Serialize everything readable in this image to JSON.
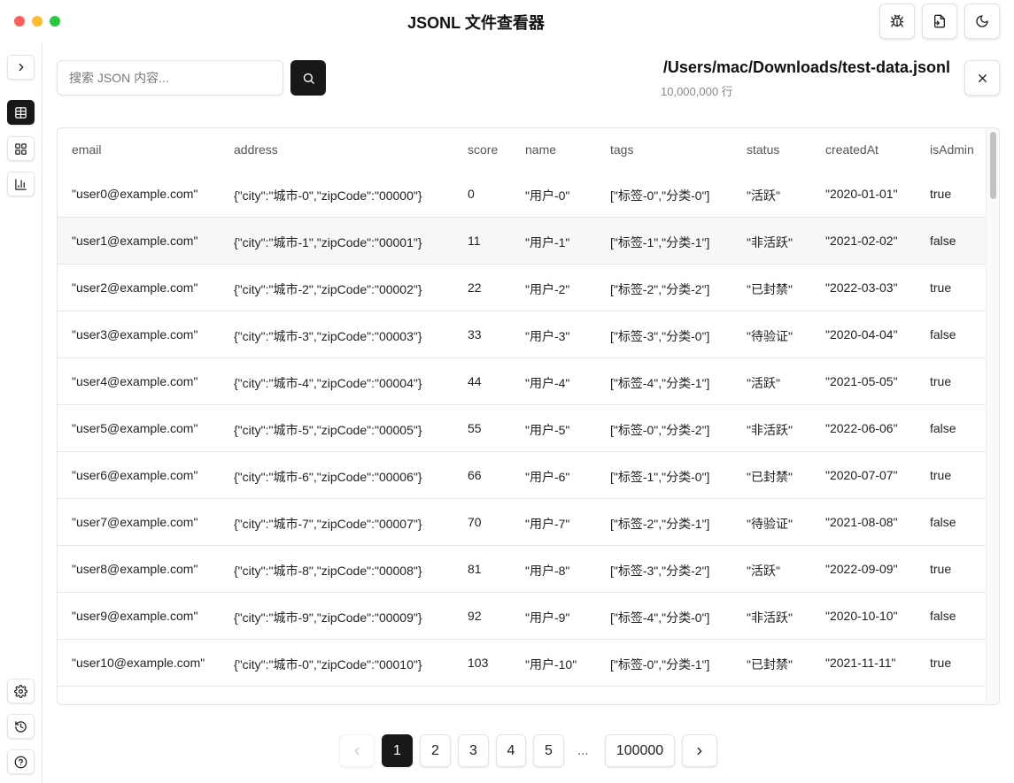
{
  "app": {
    "title": "JSONL 文件查看器"
  },
  "search": {
    "placeholder": "搜索 JSON 内容..."
  },
  "file": {
    "path": "/Users/mac/Downloads/test-data.jsonl",
    "line_count": "10,000,000 行"
  },
  "columns": [
    "email",
    "address",
    "score",
    "name",
    "tags",
    "status",
    "createdAt",
    "isAdmin"
  ],
  "rows": [
    [
      "\"user0@example.com\"",
      "{\"city\":\"城市-0\",\"zipCode\":\"00000\"}",
      "0",
      "\"用户-0\"",
      "[\"标签-0\",\"分类-0\"]",
      "\"活跃\"",
      "\"2020-01-01\"",
      "true"
    ],
    [
      "\"user1@example.com\"",
      "{\"city\":\"城市-1\",\"zipCode\":\"00001\"}",
      "11",
      "\"用户-1\"",
      "[\"标签-1\",\"分类-1\"]",
      "\"非活跃\"",
      "\"2021-02-02\"",
      "false"
    ],
    [
      "\"user2@example.com\"",
      "{\"city\":\"城市-2\",\"zipCode\":\"00002\"}",
      "22",
      "\"用户-2\"",
      "[\"标签-2\",\"分类-2\"]",
      "\"已封禁\"",
      "\"2022-03-03\"",
      "true"
    ],
    [
      "\"user3@example.com\"",
      "{\"city\":\"城市-3\",\"zipCode\":\"00003\"}",
      "33",
      "\"用户-3\"",
      "[\"标签-3\",\"分类-0\"]",
      "\"待验证\"",
      "\"2020-04-04\"",
      "false"
    ],
    [
      "\"user4@example.com\"",
      "{\"city\":\"城市-4\",\"zipCode\":\"00004\"}",
      "44",
      "\"用户-4\"",
      "[\"标签-4\",\"分类-1\"]",
      "\"活跃\"",
      "\"2021-05-05\"",
      "true"
    ],
    [
      "\"user5@example.com\"",
      "{\"city\":\"城市-5\",\"zipCode\":\"00005\"}",
      "55",
      "\"用户-5\"",
      "[\"标签-0\",\"分类-2\"]",
      "\"非活跃\"",
      "\"2022-06-06\"",
      "false"
    ],
    [
      "\"user6@example.com\"",
      "{\"city\":\"城市-6\",\"zipCode\":\"00006\"}",
      "66",
      "\"用户-6\"",
      "[\"标签-1\",\"分类-0\"]",
      "\"已封禁\"",
      "\"2020-07-07\"",
      "true"
    ],
    [
      "\"user7@example.com\"",
      "{\"city\":\"城市-7\",\"zipCode\":\"00007\"}",
      "70",
      "\"用户-7\"",
      "[\"标签-2\",\"分类-1\"]",
      "\"待验证\"",
      "\"2021-08-08\"",
      "false"
    ],
    [
      "\"user8@example.com\"",
      "{\"city\":\"城市-8\",\"zipCode\":\"00008\"}",
      "81",
      "\"用户-8\"",
      "[\"标签-3\",\"分类-2\"]",
      "\"活跃\"",
      "\"2022-09-09\"",
      "true"
    ],
    [
      "\"user9@example.com\"",
      "{\"city\":\"城市-9\",\"zipCode\":\"00009\"}",
      "92",
      "\"用户-9\"",
      "[\"标签-4\",\"分类-0\"]",
      "\"非活跃\"",
      "\"2020-10-10\"",
      "false"
    ],
    [
      "\"user10@example.com\"",
      "{\"city\":\"城市-0\",\"zipCode\":\"00010\"}",
      "103",
      "\"用户-10\"",
      "[\"标签-0\",\"分类-1\"]",
      "\"已封禁\"",
      "\"2021-11-11\"",
      "true"
    ]
  ],
  "pagination": {
    "pages": [
      "1",
      "2",
      "3",
      "4",
      "5"
    ],
    "current": "1",
    "ellipsis": "...",
    "last": "100000"
  },
  "icons": {
    "titlebar": [
      "bug-icon",
      "export-icon",
      "moon-icon"
    ],
    "sidebar_top": [
      "chevron-right-icon",
      "table-icon",
      "grid-icon",
      "bar-chart-icon"
    ],
    "sidebar_bottom": [
      "settings-icon",
      "history-icon",
      "help-icon"
    ],
    "search": "search-icon",
    "close": "close-icon"
  },
  "colors": {
    "primary": "#18181b",
    "border": "#e4e4e7",
    "row_hover": "#f7f7f7"
  }
}
